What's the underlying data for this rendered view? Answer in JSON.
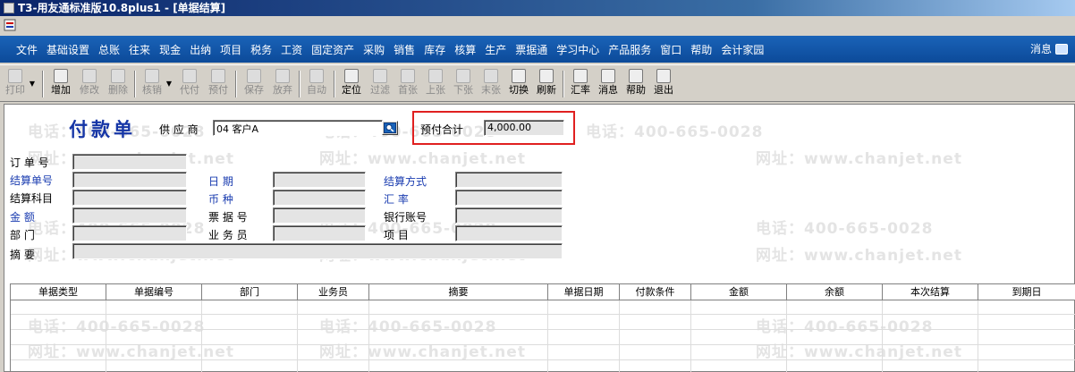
{
  "window": {
    "title": "T3-用友通标准版10.8plus1 - [单据结算]"
  },
  "menu": {
    "items": [
      "文件",
      "基础设置",
      "总账",
      "往来",
      "现金",
      "出纳",
      "项目",
      "税务",
      "工资",
      "固定资产",
      "采购",
      "销售",
      "库存",
      "核算",
      "生产",
      "票据通",
      "学习中心",
      "产品服务",
      "窗口",
      "帮助",
      "会计家园"
    ],
    "message_label": "消息"
  },
  "toolbar": {
    "print": "打印",
    "add": "增加",
    "edit": "修改",
    "delete": "删除",
    "writeoff": "核销",
    "subst": "代付",
    "prepay": "预付",
    "save": "保存",
    "abandon": "放弃",
    "auto": "自动",
    "locate": "定位",
    "filter": "过滤",
    "first": "首张",
    "prev": "上张",
    "next": "下张",
    "last": "末张",
    "switch": "切换",
    "refresh": "刷新",
    "rate": "汇率",
    "message": "消息",
    "help": "帮助",
    "exit": "退出"
  },
  "form": {
    "title": "付款单",
    "supplier_label": "供 应 商",
    "supplier_value": "04  客户A",
    "prepay_total_label": "预付合计",
    "prepay_total_value": "4,000.00",
    "order_no_label": "订 单 号",
    "settle_no_label": "结算单号",
    "date_label": "日    期",
    "settle_method_label": "结算方式",
    "settle_subject_label": "结算科目",
    "currency_label": "币    种",
    "exchange_rate_label": "汇    率",
    "amount_label": "金    额",
    "bill_no_label": "票 据 号",
    "bank_account_label": "银行账号",
    "dept_label": "部    门",
    "salesman_label": "业 务 员",
    "project_label": "项    目",
    "summary_label": "摘    要"
  },
  "grid": {
    "columns": [
      "单据类型",
      "单据编号",
      "部门",
      "业务员",
      "摘要",
      "单据日期",
      "付款条件",
      "金额",
      "余额",
      "本次结算",
      "到期日"
    ]
  },
  "watermarks": {
    "phone": "电话：400-665-0028",
    "site": "网址：www.chanjet.net"
  },
  "colors": {
    "menu_bg": "#0c4a99",
    "title_blue": "#1535a6",
    "highlight_red": "#e02020"
  }
}
